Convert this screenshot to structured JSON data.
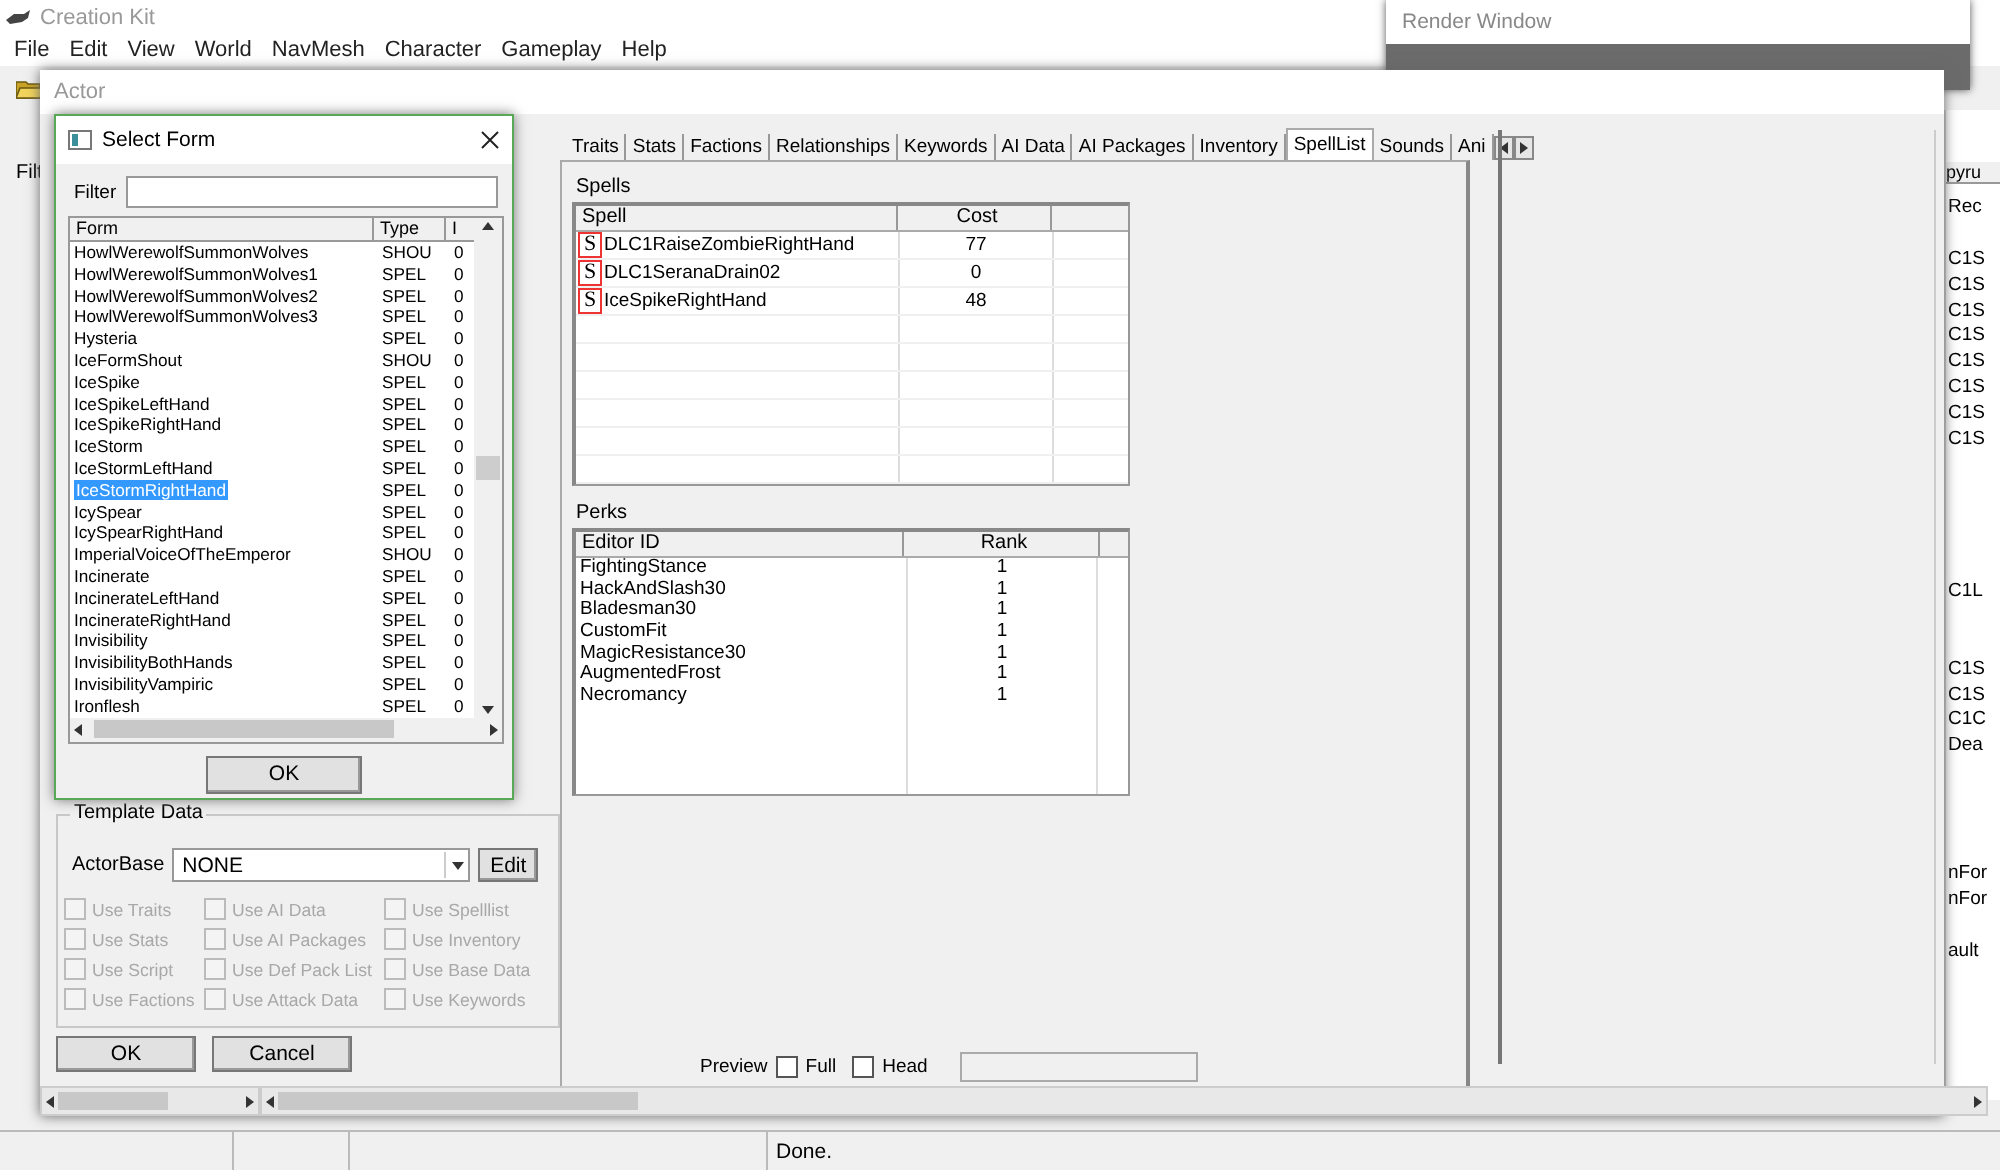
{
  "app": {
    "title": "Creation Kit",
    "menu": [
      "File",
      "Edit",
      "View",
      "World",
      "NavMesh",
      "Character",
      "Gameplay",
      "Help"
    ]
  },
  "render_window": {
    "title": "Render Window"
  },
  "background_panel": {
    "filter_label": "Filt"
  },
  "background_list": {
    "header": "pyru",
    "rows": [
      "Rec",
      "C1S",
      "C1S",
      "C1S",
      "C1S",
      "C1S",
      "C1S",
      "C1S",
      "C1S",
      "C1L",
      "C1S",
      "C1S",
      "C1C",
      "Dea",
      "nFor",
      "nFor",
      "ault"
    ]
  },
  "actor_window": {
    "title": "Actor",
    "tabs": [
      {
        "label": "Traits",
        "selected": false
      },
      {
        "label": "Stats",
        "selected": false
      },
      {
        "label": "Factions",
        "selected": false
      },
      {
        "label": "Relationships",
        "selected": false
      },
      {
        "label": "Keywords",
        "selected": false
      },
      {
        "label": "AI Data",
        "selected": false
      },
      {
        "label": "AI Packages",
        "selected": false
      },
      {
        "label": "Inventory",
        "selected": false
      },
      {
        "label": "SpellList",
        "selected": true
      },
      {
        "label": "Sounds",
        "selected": false
      },
      {
        "label": "Ani",
        "selected": false
      }
    ],
    "spells": {
      "title": "Spells",
      "columns": [
        "Spell",
        "Cost"
      ],
      "rows": [
        {
          "icon": "S",
          "name": "DLC1RaiseZombieRightHand",
          "cost": "77"
        },
        {
          "icon": "S",
          "name": "DLC1SeranaDrain02",
          "cost": "0"
        },
        {
          "icon": "S",
          "name": "IceSpikeRightHand",
          "cost": "48"
        }
      ]
    },
    "perks": {
      "title": "Perks",
      "columns": [
        "Editor ID",
        "Rank"
      ],
      "rows": [
        {
          "name": "FightingStance",
          "rank": "1"
        },
        {
          "name": "HackAndSlash30",
          "rank": "1"
        },
        {
          "name": "Bladesman30",
          "rank": "1"
        },
        {
          "name": "CustomFit",
          "rank": "1"
        },
        {
          "name": "MagicResistance30",
          "rank": "1"
        },
        {
          "name": "AugmentedFrost",
          "rank": "1"
        },
        {
          "name": "Necromancy",
          "rank": "1"
        }
      ]
    },
    "preview": {
      "label": "Preview",
      "options": [
        {
          "label": "Full",
          "checked": false
        },
        {
          "label": "Head",
          "checked": false
        }
      ]
    },
    "template": {
      "title": "Template Data",
      "actor_base_label": "ActorBase",
      "actor_base": "NONE",
      "edit_button": "Edit",
      "options": [
        {
          "label": "Use Traits",
          "checked": false,
          "disabled": true
        },
        {
          "label": "Use AI Data",
          "checked": false,
          "disabled": true
        },
        {
          "label": "Use Spelllist",
          "checked": false,
          "disabled": true
        },
        {
          "label": "Use Stats",
          "checked": false,
          "disabled": true
        },
        {
          "label": "Use AI Packages",
          "checked": false,
          "disabled": true
        },
        {
          "label": "Use Inventory",
          "checked": false,
          "disabled": true
        },
        {
          "label": "Use Script",
          "checked": false,
          "disabled": true
        },
        {
          "label": "Use Def Pack List",
          "checked": false,
          "disabled": true
        },
        {
          "label": "Use Base Data",
          "checked": false,
          "disabled": true
        },
        {
          "label": "Use Factions",
          "checked": false,
          "disabled": true
        },
        {
          "label": "Use Attack Data",
          "checked": false,
          "disabled": true
        },
        {
          "label": "Use Keywords",
          "checked": false,
          "disabled": true
        }
      ]
    },
    "buttons": [
      "OK",
      "Cancel"
    ]
  },
  "select_form": {
    "title": "Select Form",
    "filter_label": "Filter",
    "columns": [
      "Form",
      "Type",
      "I"
    ],
    "rows": [
      {
        "form": "HowlWerewolfSummonWolves",
        "type": "SHOU",
        "id": "0",
        "selected": false
      },
      {
        "form": "HowlWerewolfSummonWolves1",
        "type": "SPEL",
        "id": "0",
        "selected": false
      },
      {
        "form": "HowlWerewolfSummonWolves2",
        "type": "SPEL",
        "id": "0",
        "selected": false
      },
      {
        "form": "HowlWerewolfSummonWolves3",
        "type": "SPEL",
        "id": "0",
        "selected": false
      },
      {
        "form": "Hysteria",
        "type": "SPEL",
        "id": "0",
        "selected": false
      },
      {
        "form": "IceFormShout",
        "type": "SHOU",
        "id": "0",
        "selected": false
      },
      {
        "form": "IceSpike",
        "type": "SPEL",
        "id": "0",
        "selected": false
      },
      {
        "form": "IceSpikeLeftHand",
        "type": "SPEL",
        "id": "0",
        "selected": false
      },
      {
        "form": "IceSpikeRightHand",
        "type": "SPEL",
        "id": "0",
        "selected": false
      },
      {
        "form": "IceStorm",
        "type": "SPEL",
        "id": "0",
        "selected": false
      },
      {
        "form": "IceStormLeftHand",
        "type": "SPEL",
        "id": "0",
        "selected": false
      },
      {
        "form": "IceStormRightHand",
        "type": "SPEL",
        "id": "0",
        "selected": true
      },
      {
        "form": "IcySpear",
        "type": "SPEL",
        "id": "0",
        "selected": false
      },
      {
        "form": "IcySpearRightHand",
        "type": "SPEL",
        "id": "0",
        "selected": false
      },
      {
        "form": "ImperialVoiceOfTheEmperor",
        "type": "SHOU",
        "id": "0",
        "selected": false
      },
      {
        "form": "Incinerate",
        "type": "SPEL",
        "id": "0",
        "selected": false
      },
      {
        "form": "IncinerateLeftHand",
        "type": "SPEL",
        "id": "0",
        "selected": false
      },
      {
        "form": "IncinerateRightHand",
        "type": "SPEL",
        "id": "0",
        "selected": false
      },
      {
        "form": "Invisibility",
        "type": "SPEL",
        "id": "0",
        "selected": false
      },
      {
        "form": "InvisibilityBothHands",
        "type": "SPEL",
        "id": "0",
        "selected": false
      },
      {
        "form": "InvisibilityVampiric",
        "type": "SPEL",
        "id": "0",
        "selected": false
      },
      {
        "form": "Ironflesh",
        "type": "SPEL",
        "id": "0",
        "selected": false
      }
    ],
    "ok_button": "OK"
  },
  "status_bar": {
    "text": "Done."
  }
}
